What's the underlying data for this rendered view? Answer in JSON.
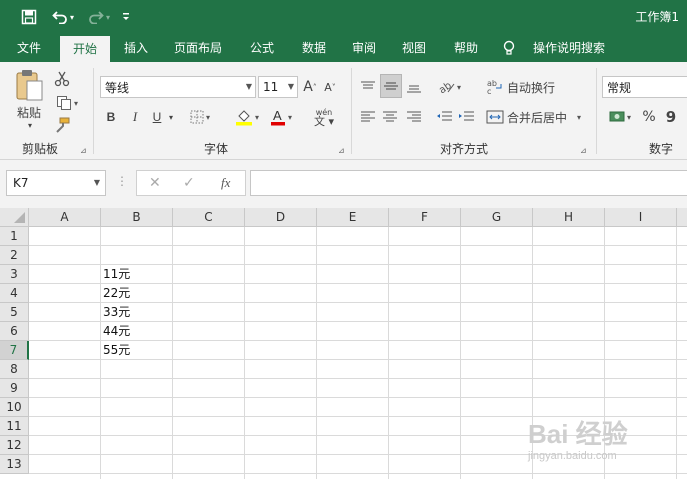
{
  "window": {
    "title": "工作簿1"
  },
  "tabs": [
    {
      "label": "文件"
    },
    {
      "label": "开始"
    },
    {
      "label": "插入"
    },
    {
      "label": "页面布局"
    },
    {
      "label": "公式"
    },
    {
      "label": "数据"
    },
    {
      "label": "审阅"
    },
    {
      "label": "视图"
    },
    {
      "label": "帮助"
    },
    {
      "label": "操作说明搜索"
    }
  ],
  "ribbon": {
    "clipboard": {
      "paste_label": "粘贴",
      "group_label": "剪贴板"
    },
    "font": {
      "font_name": "等线",
      "font_size": "11",
      "bold": "B",
      "italic": "I",
      "underline": "U",
      "increase_size": "A",
      "decrease_size": "A",
      "phonetic": "wén",
      "group_label": "字体"
    },
    "alignment": {
      "wrap_text": "自动换行",
      "merge_center": "合并后居中",
      "group_label": "对齐方式"
    },
    "number": {
      "format": "常规",
      "percent": "%",
      "comma": "9",
      "group_label": "数字"
    }
  },
  "formula_bar": {
    "name_box": "K7",
    "fx": "fx",
    "formula": ""
  },
  "sheet": {
    "columns": [
      "A",
      "B",
      "C",
      "D",
      "E",
      "F",
      "G",
      "H",
      "I"
    ],
    "rows": [
      "1",
      "2",
      "3",
      "4",
      "5",
      "6",
      "7",
      "8",
      "9",
      "10",
      "11",
      "12",
      "13"
    ],
    "selected_row": "7",
    "cells": [
      {
        "ref": "B3",
        "value": "11元"
      },
      {
        "ref": "B4",
        "value": "22元"
      },
      {
        "ref": "B5",
        "value": "33元"
      },
      {
        "ref": "B6",
        "value": "44元"
      },
      {
        "ref": "B7",
        "value": "55元"
      }
    ]
  },
  "watermark": {
    "text": "Bai 经验",
    "url": "jingyan.baidu.com"
  },
  "colors": {
    "accent": "#217346",
    "ribbon_bg": "#f3f3f3",
    "header_bg": "#e6e6e6",
    "gridline": "#dadada"
  }
}
